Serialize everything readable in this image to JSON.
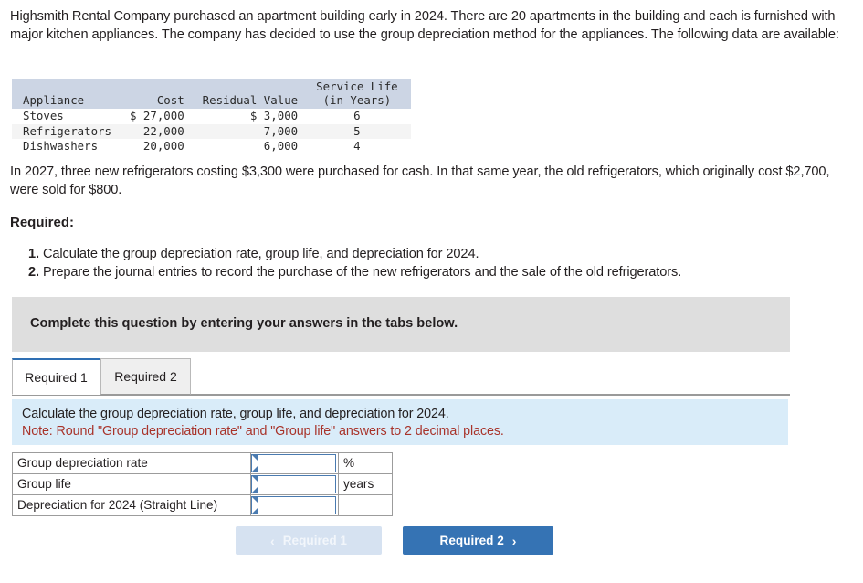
{
  "intro": {
    "paragraph": "Highsmith Rental Company purchased an apartment building early in 2024. There are 20 apartments in the building and each is furnished with major kitchen appliances. The company has decided to use the group depreciation method for the appliances. The following data are available:"
  },
  "appliance_table": {
    "headers": {
      "appliance": "Appliance",
      "cost": "Cost",
      "residual": "Residual Value",
      "service_life_line1": "Service Life",
      "service_life_line2": "(in Years)"
    },
    "rows": [
      {
        "appliance": "Stoves",
        "cost": "$ 27,000",
        "residual": "$ 3,000",
        "life": "6"
      },
      {
        "appliance": "Refrigerators",
        "cost": "22,000",
        "residual": "7,000",
        "life": "5"
      },
      {
        "appliance": "Dishwashers",
        "cost": "20,000",
        "residual": "6,000",
        "life": "4"
      }
    ]
  },
  "purchase": {
    "paragraph": "In 2027, three new refrigerators costing $3,300 were purchased for cash. In that same year, the old refrigerators, which originally cost $2,700, were sold for $800."
  },
  "required": {
    "heading": "Required:",
    "items": [
      {
        "num": "1.",
        "text": "Calculate the group depreciation rate, group life, and depreciation for 2024."
      },
      {
        "num": "2.",
        "text": "Prepare the journal entries to record the purchase of the new refrigerators and the sale of the old refrigerators."
      }
    ]
  },
  "banner": {
    "text": "Complete this question by entering your answers in the tabs below."
  },
  "tabs": [
    {
      "label": "Required 1",
      "active": true
    },
    {
      "label": "Required 2",
      "active": false
    }
  ],
  "instruction": {
    "line1": "Calculate the group depreciation rate, group life, and depreciation for 2024.",
    "line2": "Note: Round \"Group depreciation rate\" and \"Group life\" answers to 2 decimal places."
  },
  "answer_table": {
    "rows": [
      {
        "label": "Group depreciation rate",
        "value": "",
        "unit": "%"
      },
      {
        "label": "Group life",
        "value": "",
        "unit": "years"
      },
      {
        "label": "Depreciation for 2024 (Straight Line)",
        "value": "",
        "unit": ""
      }
    ]
  },
  "nav": {
    "prev_label": "Required 1",
    "next_label": "Required 2",
    "prev_chevron": "‹",
    "next_chevron": "›"
  },
  "colors": {
    "accent_blue": "#3573b4",
    "light_blue_button": "#d6e2f1",
    "panel_blue": "#d9ecf9",
    "banner_gray": "#dedede",
    "table_header": "#ccd5e4",
    "note_red": "#a8332a",
    "input_border": "#4a7bb0"
  }
}
